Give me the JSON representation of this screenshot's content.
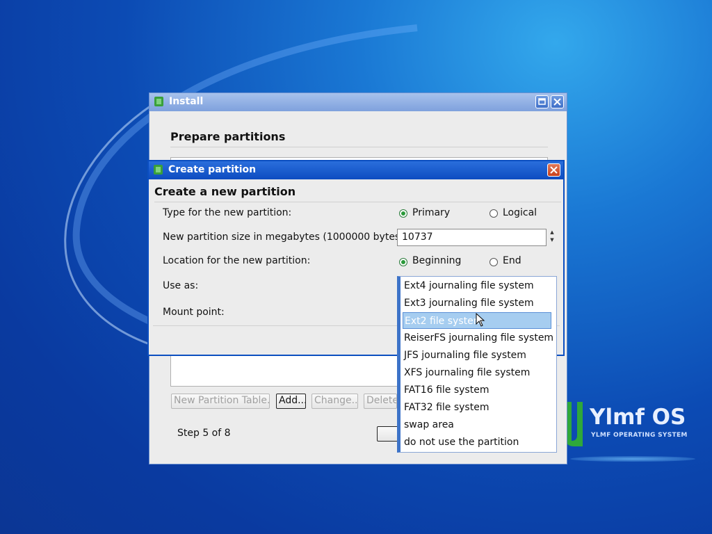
{
  "install_window": {
    "title": "Install",
    "heading": "Prepare partitions",
    "buttons": {
      "new_partition_table": "New Partition Table...",
      "add": "Add...",
      "change": "Change...",
      "delete": "Delete"
    },
    "step": "Step 5 of 8"
  },
  "create_partition": {
    "title": "Create partition",
    "heading": "Create a new partition",
    "type_label": "Type for the new partition:",
    "type_options": [
      "Primary",
      "Logical"
    ],
    "type_selected": "Primary",
    "size_label": "New partition size in megabytes (1000000 bytes):",
    "size_value": "10737",
    "location_label": "Location for the new partition:",
    "location_options": [
      "Beginning",
      "End"
    ],
    "location_selected": "Beginning",
    "use_as_label": "Use as:",
    "mount_point_label": "Mount point:"
  },
  "use_as_dropdown": {
    "options": [
      "Ext4 journaling file system",
      "Ext3 journaling file system",
      "Ext2 file system",
      "ReiserFS journaling file system",
      "JFS journaling file system",
      "XFS journaling file system",
      "FAT16 file system",
      "FAT32 file system",
      "swap area",
      "do not use the partition"
    ],
    "highlighted": "Ext2 file system"
  },
  "logo": {
    "title": "Ylmf OS",
    "subtitle": "YLMF OPERATING SYSTEM"
  },
  "colors": {
    "desktop": "#0c4bb4",
    "active_title": "#0d4cc0",
    "selection": "#a6cdf0"
  }
}
